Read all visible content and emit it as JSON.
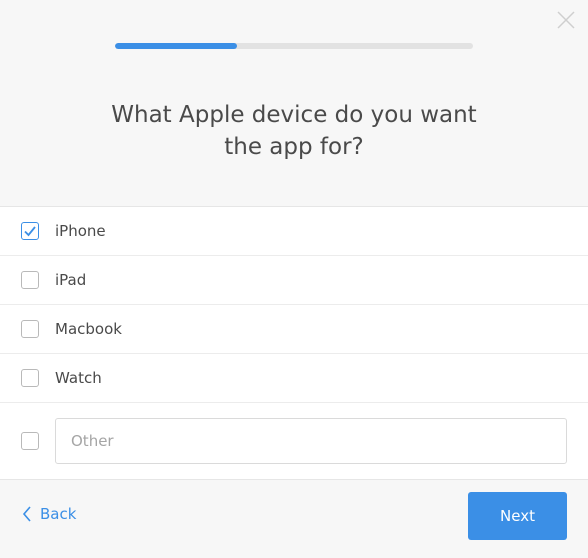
{
  "window": {
    "close_icon": "close-icon"
  },
  "progress": {
    "fraction": 0.34,
    "fill_color": "#3b8fe6"
  },
  "question": {
    "line1": "What Apple device do you want",
    "line2": "the app for?"
  },
  "options": [
    {
      "label": "iPhone",
      "checked": true
    },
    {
      "label": "iPad",
      "checked": false
    },
    {
      "label": "Macbook",
      "checked": false
    },
    {
      "label": "Watch",
      "checked": false
    }
  ],
  "other": {
    "checked": false,
    "placeholder": "Other",
    "value": ""
  },
  "footer": {
    "back_label": "Back",
    "back_icon": "chevron-left-icon",
    "next_label": "Next"
  },
  "colors": {
    "accent": "#3b8fe6",
    "background": "#f7f7f7"
  }
}
